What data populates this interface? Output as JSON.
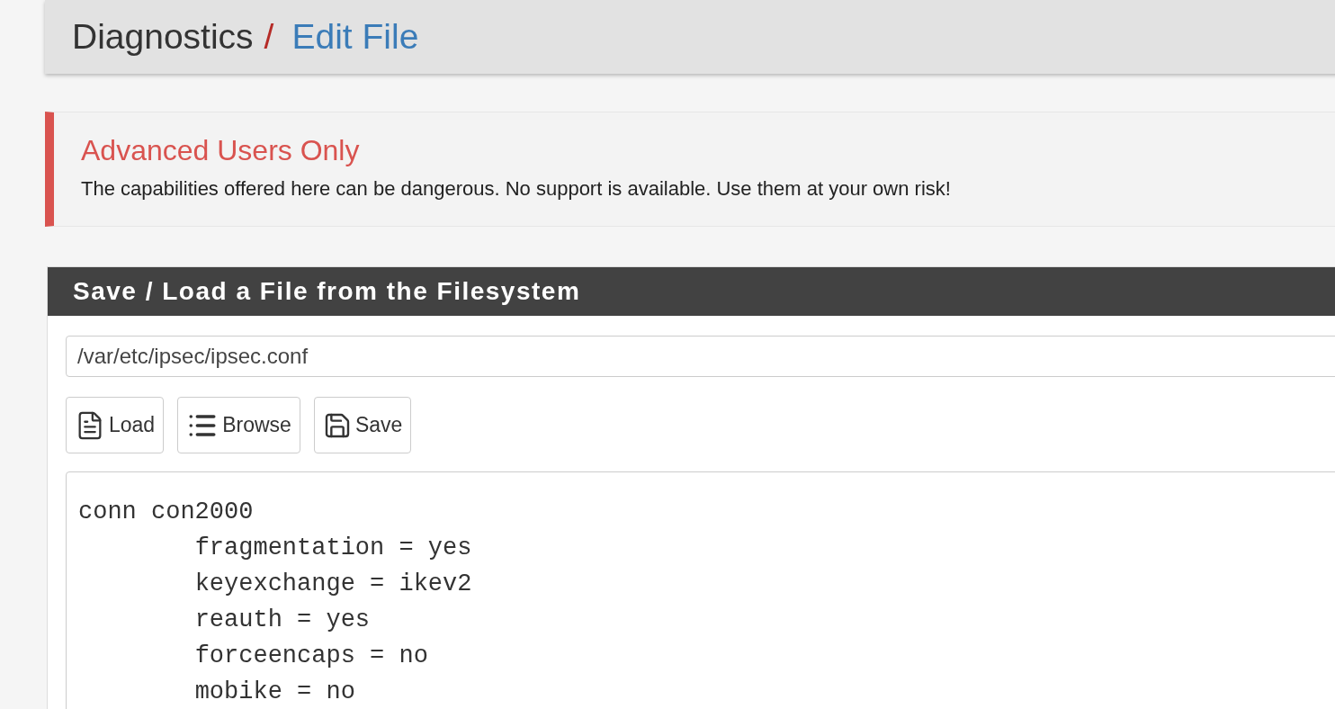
{
  "breadcrumb": {
    "section": "Diagnostics",
    "separator": "/",
    "page": "Edit File"
  },
  "alert": {
    "title": "Advanced Users Only",
    "message": "The capabilities offered here can be dangerous. No support is available. Use them at your own risk!"
  },
  "panel": {
    "title": "Save / Load a File from the Filesystem",
    "path_field": {
      "value": "/var/etc/ipsec/ipsec.conf"
    },
    "buttons": [
      {
        "kind": "load",
        "label": "Load"
      },
      {
        "kind": "browse",
        "label": "Browse"
      },
      {
        "kind": "save",
        "label": "Save"
      }
    ],
    "file_lines": [
      "conn con2000",
      "\tfragmentation = yes",
      "\tkeyexchange = ikev2",
      "\treauth = yes",
      "\tforceencaps = no",
      "\tmobike = no"
    ]
  }
}
